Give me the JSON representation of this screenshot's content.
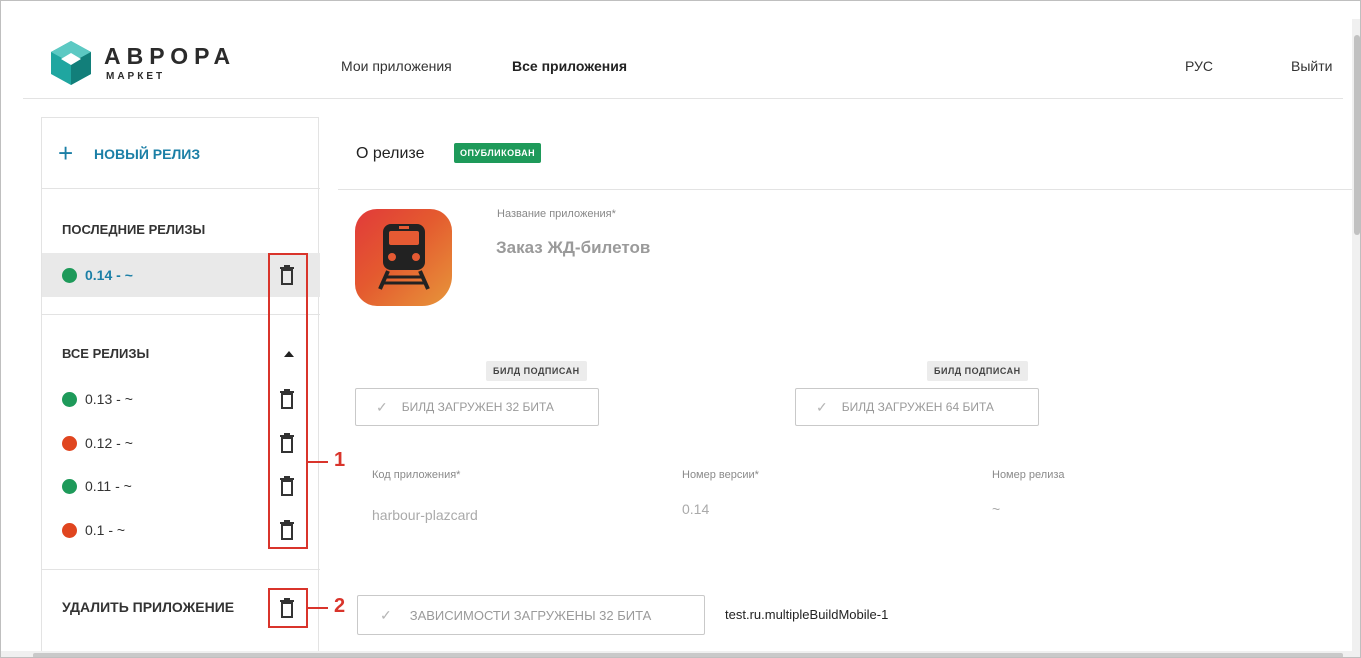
{
  "header": {
    "brand_title": "АВРОРА",
    "brand_subtitle": "МАРКЕТ",
    "nav": {
      "my_apps": "Мои приложения",
      "all_apps": "Все приложения",
      "language": "РУС",
      "logout": "Выйти"
    }
  },
  "sidebar": {
    "new_release": "НОВЫЙ РЕЛИЗ",
    "latest_title": "ПОСЛЕДНИЕ РЕЛИЗЫ",
    "latest": {
      "version": "0.14 - ~",
      "status_color": "#1e9a5a"
    },
    "all_title": "ВСЕ РЕЛИЗЫ",
    "releases": [
      {
        "version": "0.13 - ~",
        "status_color": "#1e9a5a"
      },
      {
        "version": "0.12 - ~",
        "status_color": "#e0451f"
      },
      {
        "version": "0.11 - ~",
        "status_color": "#1e9a5a"
      },
      {
        "version": "0.1 - ~",
        "status_color": "#e0451f"
      }
    ],
    "delete_app": "УДАЛИТЬ ПРИЛОЖЕНИЕ"
  },
  "annotations": {
    "one": "1",
    "two": "2",
    "color": "#d9342b"
  },
  "release": {
    "about": "О релизе",
    "status_badge": "ОПУБЛИКОВАН",
    "app_name_label": "Название приложения*",
    "app_name": "Заказ ЖД-билетов",
    "build_signed_32": "БИЛД ПОДПИСАН",
    "build_signed_64": "БИЛД ПОДПИСАН",
    "build_32": "БИЛД ЗАГРУЖЕН 32 БИТА",
    "build_64": "БИЛД ЗАГРУЖЕН 64 БИТА",
    "app_code_label": "Код приложения*",
    "app_code": "harbour-plazcard",
    "version_label": "Номер версии*",
    "version": "0.14",
    "release_no_label": "Номер релиза",
    "release_no": "~",
    "deps_32": "ЗАВИСИМОСТИ ЗАГРУЖЕНЫ 32 БИТА",
    "deps_name": "test.ru.multipleBuildMobile-1"
  }
}
